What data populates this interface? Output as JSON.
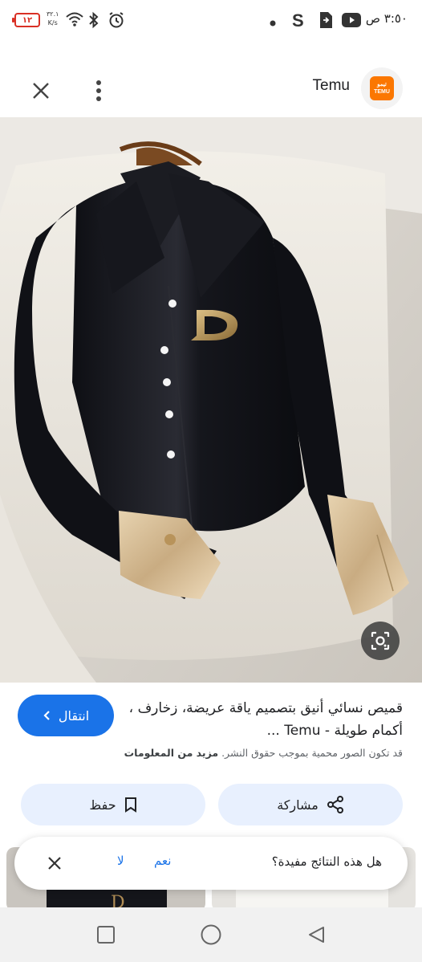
{
  "status_bar": {
    "time": "٣:٥٠ ص",
    "battery": "١٢",
    "net_speed_value": "٣٢.١",
    "net_speed_unit": "K/s"
  },
  "header": {
    "site_name": "Temu",
    "logo_text_top": "ﺗﻴﻤﻮ",
    "logo_text_bottom": "TEMU"
  },
  "result": {
    "title": "قميص نسائي أنيق بتصميم ياقة عريضة، زخارف ، أكمام طويلة - Temu ...",
    "visit_label": "انتقال",
    "copyright_text": "قد تكون الصور محمية بموجب حقوق النشر.",
    "learn_more": "مزيد من المعلومات"
  },
  "actions": {
    "share_label": "مشاركة",
    "save_label": "حفظ"
  },
  "feedback": {
    "question": "هل هذه النتائج مفيدة؟",
    "yes_label": "نعم",
    "no_label": "لا"
  },
  "colors": {
    "accent": "#1a73e8",
    "button_bg": "#e8f0fe",
    "brand_temu": "#fb7701"
  },
  "icons": [
    "close-icon",
    "more-vert-icon",
    "lens-icon",
    "chevron-left-icon",
    "share-icon",
    "bookmark-icon",
    "square-nav-icon",
    "circle-nav-icon",
    "back-triangle-icon"
  ]
}
